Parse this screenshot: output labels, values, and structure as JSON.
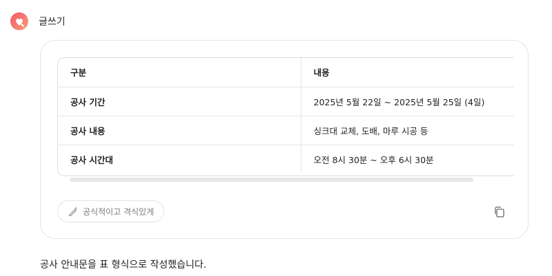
{
  "header": {
    "app_name": "글쓰기",
    "logo_icon": "gemini-heart-icon"
  },
  "table": {
    "headers": [
      "구분",
      "내용"
    ],
    "rows": [
      [
        "공사 기간",
        "2025년 5월 22일 ~ 2025년 5월 25일 (4일)"
      ],
      [
        "공사 내용",
        "싱크대 교체, 도배, 마루 시공 등"
      ],
      [
        "공사 시간대",
        "오전 8시 30분 ~ 오후 6시 30분"
      ]
    ]
  },
  "chip": {
    "label": "공식적이고 격식있게",
    "icon": "pen-sparkle-icon"
  },
  "copy_icon": "copy-icon",
  "footer": {
    "message": "공사 안내문을 표 형식으로 작성했습니다."
  },
  "colors": {
    "logo_gradient_start": "#f2566a",
    "logo_gradient_end": "#f7a07a"
  }
}
